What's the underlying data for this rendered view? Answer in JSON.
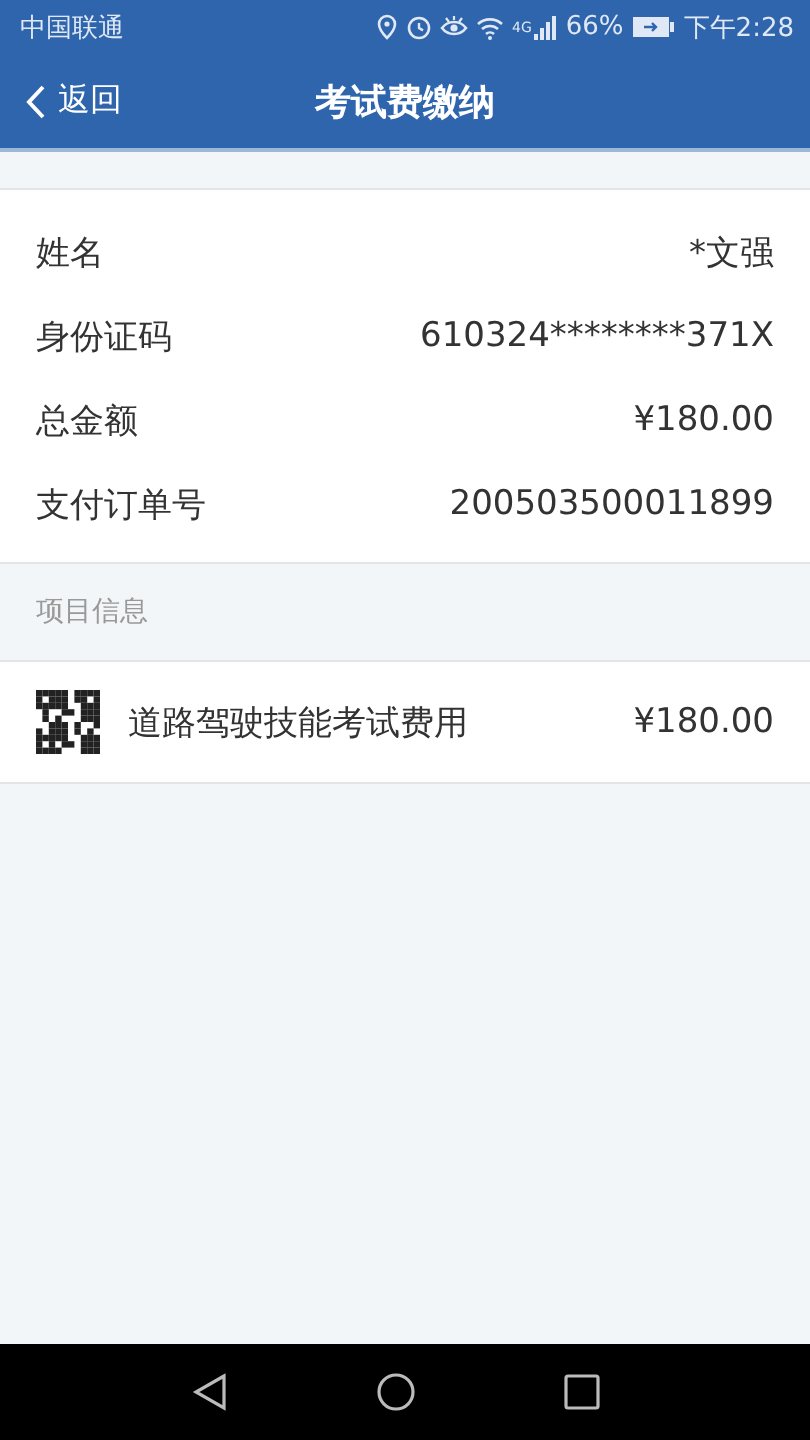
{
  "status_bar": {
    "carrier": "中国联通",
    "signal_label": "4G",
    "battery": "66%",
    "time": "下午2:28"
  },
  "header": {
    "back": "返回",
    "title": "考试费缴纳"
  },
  "details": [
    {
      "label": "姓名",
      "value": "*文强"
    },
    {
      "label": "身份证码",
      "value": "610324********371X"
    },
    {
      "label": "总金额",
      "value": "¥180.00"
    },
    {
      "label": "支付订单号",
      "value": "200503500011899"
    }
  ],
  "section_title": "项目信息",
  "items": [
    {
      "name": "道路驾驶技能考试费用",
      "amount": "¥180.00"
    }
  ]
}
